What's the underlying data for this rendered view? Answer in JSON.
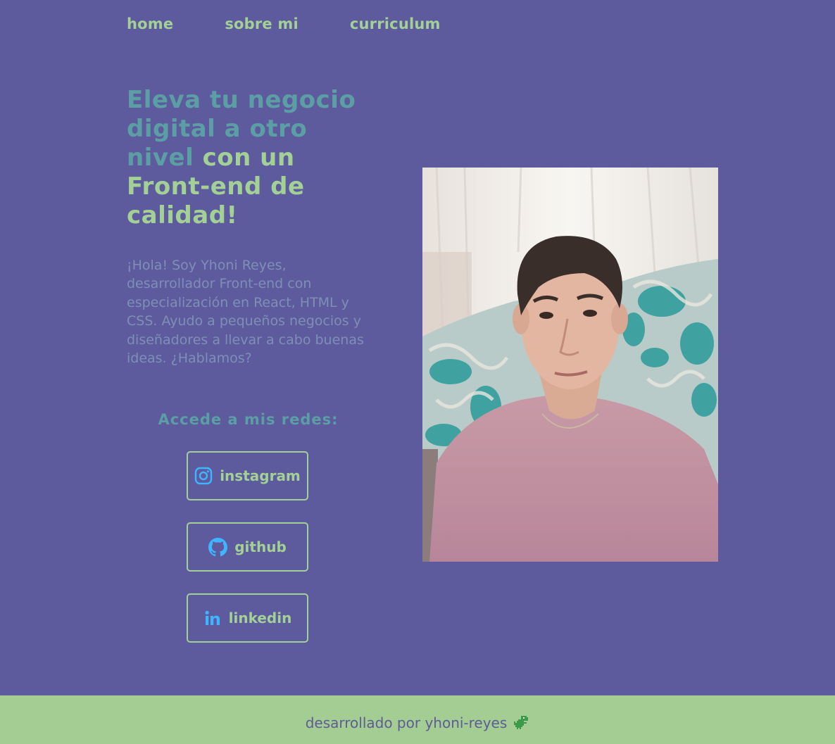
{
  "nav": {
    "home": "home",
    "about": "sobre mi",
    "cv": "curriculum"
  },
  "hero": {
    "headline_highlight": "Eleva tu negocio digital a otro nivel",
    "headline_rest": "con un Front-end de calidad!",
    "intro": "¡Hola! Soy Yhoni Reyes, desarrollador Front-end con especialización en React, HTML y CSS. Ayudo a pequeños negocios y diseñadores a llevar a cabo buenas ideas. ¿Hablamos?"
  },
  "networks": {
    "title": "Accede a mis redes:",
    "items": [
      {
        "label": "instagram",
        "icon": "instagram-icon"
      },
      {
        "label": "github",
        "icon": "github-icon"
      },
      {
        "label": "linkedin",
        "icon": "linkedin-icon"
      }
    ]
  },
  "photo": {
    "alt": "selfie-photo"
  },
  "footer": {
    "text": "desarrollado por yhoni-reyes",
    "icon": "dinosaur-icon"
  },
  "colors": {
    "background": "#5d5b9e",
    "accent_green": "#a3d095",
    "accent_teal": "#5b9fa4",
    "icon_blue": "#3fb4ff",
    "footer_bg": "#a3cd93"
  }
}
